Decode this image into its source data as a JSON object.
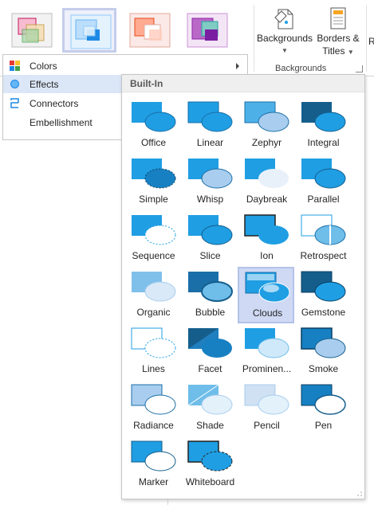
{
  "ribbon": {
    "themes": [
      {
        "icon": "theme-variant-1-icon",
        "accent": "#d81b60"
      },
      {
        "icon": "theme-variant-2-icon",
        "accent": "#1e88e5"
      },
      {
        "icon": "theme-variant-3-icon",
        "accent": "#e64a19"
      },
      {
        "icon": "theme-variant-4-icon",
        "accent": "#8e24aa"
      }
    ],
    "backgrounds_label": "Backgrounds",
    "borders_label": "Borders &",
    "titles_label": "Titles",
    "group_label": "Backgrounds",
    "clipped_label": "R"
  },
  "menu": {
    "items": [
      {
        "label": "Colors",
        "icon": "colors-icon",
        "has_submenu": true
      },
      {
        "label": "Effects",
        "icon": "effects-icon",
        "active": true
      },
      {
        "label": "Connectors",
        "icon": "connectors-icon"
      },
      {
        "label": "Embellishment",
        "icon": ""
      }
    ]
  },
  "gallery": {
    "header": "Built-In",
    "effects": [
      {
        "name": "Office"
      },
      {
        "name": "Linear"
      },
      {
        "name": "Zephyr"
      },
      {
        "name": "Integral"
      },
      {
        "name": "Simple"
      },
      {
        "name": "Whisp"
      },
      {
        "name": "Daybreak"
      },
      {
        "name": "Parallel"
      },
      {
        "name": "Sequence"
      },
      {
        "name": "Slice"
      },
      {
        "name": "Ion"
      },
      {
        "name": "Retrospect"
      },
      {
        "name": "Organic"
      },
      {
        "name": "Bubble"
      },
      {
        "name": "Clouds",
        "selected": true
      },
      {
        "name": "Gemstone"
      },
      {
        "name": "Lines"
      },
      {
        "name": "Facet"
      },
      {
        "name": "Prominen..."
      },
      {
        "name": "Smoke"
      },
      {
        "name": "Radiance"
      },
      {
        "name": "Shade"
      },
      {
        "name": "Pencil"
      },
      {
        "name": "Pen"
      },
      {
        "name": "Marker"
      },
      {
        "name": "Whiteboard"
      }
    ]
  },
  "colors": {
    "accent_blue": "#1f9ee3",
    "selection": "#cfd9f4",
    "menu_active": "#dbe6f7"
  }
}
